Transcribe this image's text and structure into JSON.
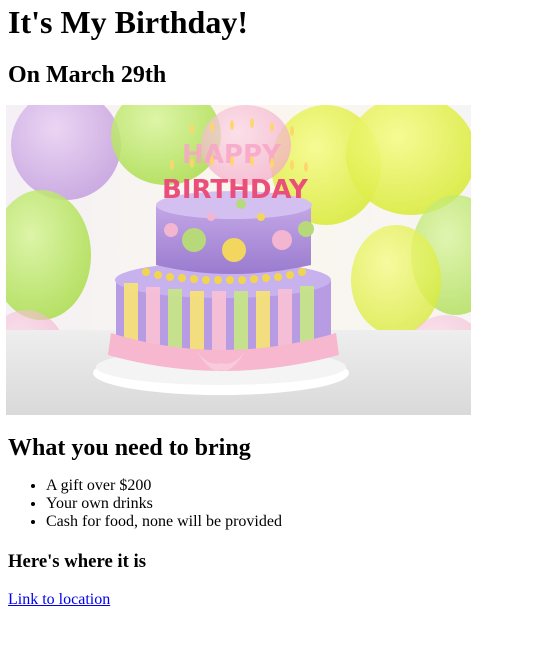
{
  "page": {
    "title": "It's My Birthday!",
    "date_heading": "On March 29th",
    "bring_heading": "What you need to bring",
    "bring_items": [
      "A gift over $200",
      "Your own drinks",
      "Cash for food, none will be provided"
    ],
    "location_heading": "Here's where it is",
    "location_link_text": "Link to location"
  },
  "image": {
    "cake_candle_text_line1": "HAPPY",
    "cake_candle_text_line2": "BIRTHDAY"
  },
  "colors": {
    "link": "#0000ee",
    "text": "#000000"
  }
}
